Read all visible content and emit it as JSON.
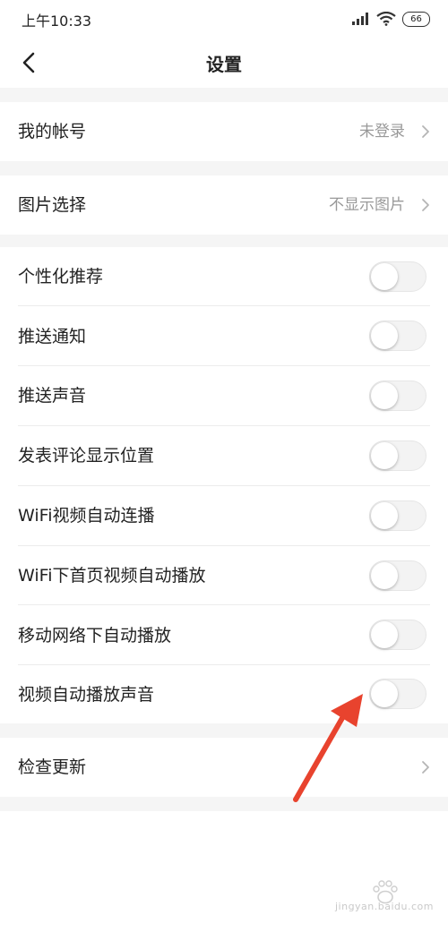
{
  "status_bar": {
    "time": "上午10:33",
    "battery": "66",
    "icons": [
      "signal-icon",
      "wifi-icon",
      "battery-icon"
    ]
  },
  "header": {
    "title": "设置",
    "back_icon": "chevron-left-icon"
  },
  "sections": {
    "account": {
      "label": "我的帐号",
      "value": "未登录"
    },
    "image": {
      "label": "图片选择",
      "value": "不显示图片"
    },
    "toggles": [
      {
        "label": "个性化推荐",
        "on": false
      },
      {
        "label": "推送通知",
        "on": false
      },
      {
        "label": "推送声音",
        "on": false
      },
      {
        "label": "发表评论显示位置",
        "on": false
      },
      {
        "label": "WiFi视频自动连播",
        "on": false
      },
      {
        "label": "WiFi下首页视频自动播放",
        "on": false
      },
      {
        "label": "移动网络下自动播放",
        "on": false
      },
      {
        "label": "视频自动播放声音",
        "on": false
      }
    ],
    "update": {
      "label": "检查更新"
    }
  },
  "colors": {
    "background": "#ffffff",
    "section_gap": "#f5f5f5",
    "text": "#222222",
    "secondary_text": "#999999",
    "annotation_arrow": "#e8432e"
  },
  "watermark": {
    "icon": "baidu-paw-icon",
    "text": "jingyan.baidu.com"
  }
}
